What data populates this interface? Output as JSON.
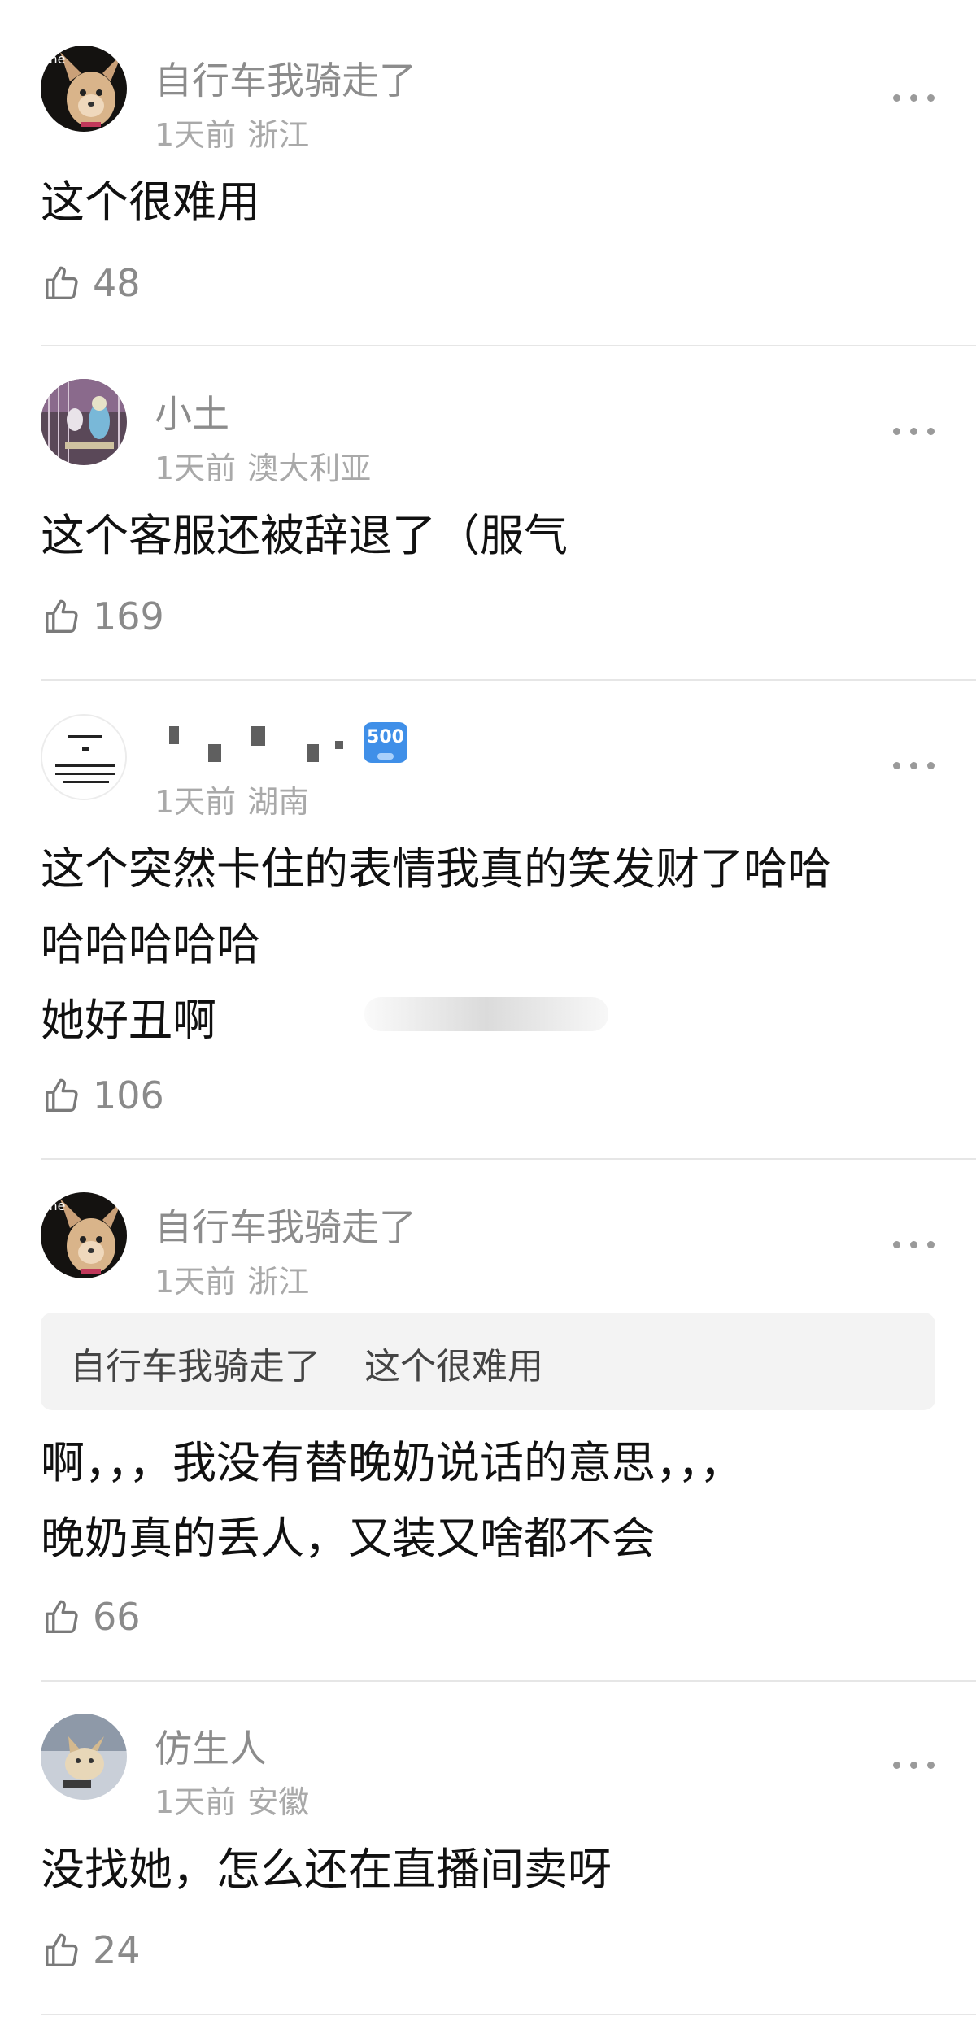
{
  "comments": [
    {
      "username": "自行车我骑走了",
      "time": "1天前",
      "location": "浙江",
      "avatar_overlay_text": "ine",
      "avatar": "chihuahua-avatar",
      "content_lines": [
        "这个很难用"
      ],
      "likes": "48"
    },
    {
      "username": "小土",
      "time": "1天前",
      "location": "澳大利亚",
      "avatar": "parrot-avatar",
      "content_lines": [
        "这个客服还被辞退了（服气"
      ],
      "likes": "169"
    },
    {
      "username_blurred": true,
      "badge": "500",
      "time": "1天前",
      "location": "湖南",
      "avatar": "text-note-avatar",
      "content_lines": [
        "这个突然卡住的表情我真的笑发财了哈哈",
        "哈哈哈哈哈",
        "她好丑啊"
      ],
      "likes": "106"
    },
    {
      "username": "自行车我骑走了",
      "time": "1天前",
      "location": "浙江",
      "avatar_overlay_text": "ine",
      "avatar": "chihuahua-avatar",
      "quote": {
        "author": "自行车我骑走了",
        "text": "这个很难用"
      },
      "content_lines": [
        "啊，，，我没有替晚奶说话的意思，，，",
        "晚奶真的丢人，又装又啥都不会"
      ],
      "likes": "66"
    },
    {
      "username": "仿生人",
      "time": "1天前",
      "location": "安徽",
      "avatar": "cat-avatar",
      "content_lines": [
        "没找她，怎么还在直播间卖呀"
      ],
      "likes": "24"
    }
  ],
  "icons": {
    "like": "thumbs-up-icon",
    "more": "more-dots-icon"
  },
  "colors": {
    "username": "#8c8c8c",
    "meta": "#a9a9a9",
    "divider": "#e6e6e6",
    "badge": "#3f8fe8"
  }
}
